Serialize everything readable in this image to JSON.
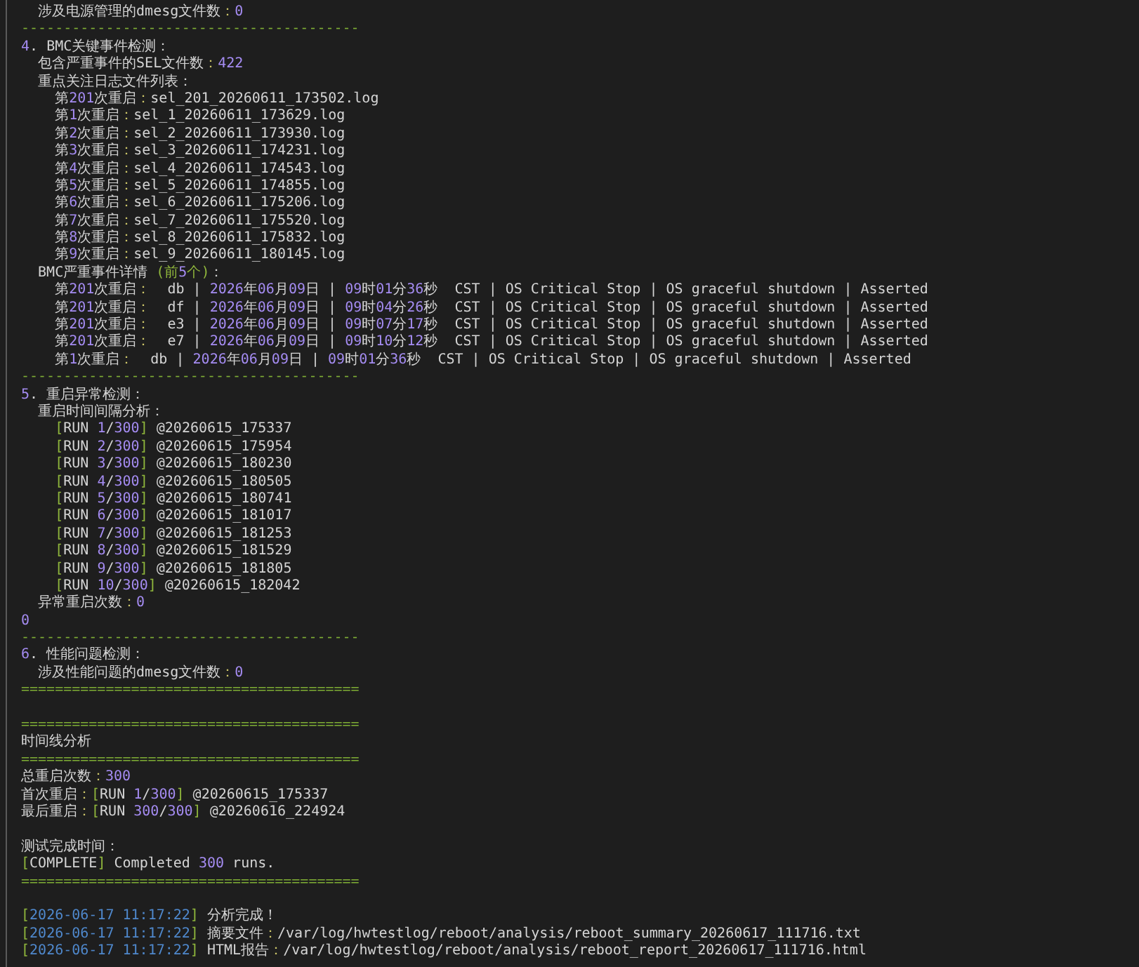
{
  "terminal": {
    "lines": [
      {
        "kind": "text",
        "parts": [
          {
            "kind": "plain",
            "text": "  涉及电源管理的dmesg文件数"
          },
          {
            "kind": "colon",
            "text": "："
          },
          {
            "kind": "num",
            "text": "0"
          }
        ]
      },
      {
        "kind": "rule",
        "text": "----------------------------------------"
      },
      {
        "kind": "text",
        "parts": [
          {
            "kind": "num",
            "text": "4"
          },
          {
            "kind": "plain",
            "text": ". BMC关键事件检测："
          }
        ]
      },
      {
        "kind": "text",
        "parts": [
          {
            "kind": "plain",
            "text": "  包含严重事件的SEL文件数"
          },
          {
            "kind": "colon",
            "text": "："
          },
          {
            "kind": "num",
            "text": "422"
          }
        ]
      },
      {
        "kind": "text",
        "parts": [
          {
            "kind": "plain",
            "text": "  重点关注日志文件列表："
          }
        ]
      },
      {
        "kind": "text",
        "parts": [
          {
            "kind": "plain",
            "text": "    第"
          },
          {
            "kind": "num",
            "text": "201"
          },
          {
            "kind": "plain",
            "text": "次重启"
          },
          {
            "kind": "colon",
            "text": "："
          },
          {
            "kind": "plain",
            "text": "sel_201_20260611_173502.log"
          }
        ]
      },
      {
        "kind": "text",
        "parts": [
          {
            "kind": "plain",
            "text": "    第"
          },
          {
            "kind": "num",
            "text": "1"
          },
          {
            "kind": "plain",
            "text": "次重启"
          },
          {
            "kind": "colon",
            "text": "："
          },
          {
            "kind": "plain",
            "text": "sel_1_20260611_173629.log"
          }
        ]
      },
      {
        "kind": "text",
        "parts": [
          {
            "kind": "plain",
            "text": "    第"
          },
          {
            "kind": "num",
            "text": "2"
          },
          {
            "kind": "plain",
            "text": "次重启"
          },
          {
            "kind": "colon",
            "text": "："
          },
          {
            "kind": "plain",
            "text": "sel_2_20260611_173930.log"
          }
        ]
      },
      {
        "kind": "text",
        "parts": [
          {
            "kind": "plain",
            "text": "    第"
          },
          {
            "kind": "num",
            "text": "3"
          },
          {
            "kind": "plain",
            "text": "次重启"
          },
          {
            "kind": "colon",
            "text": "："
          },
          {
            "kind": "plain",
            "text": "sel_3_20260611_174231.log"
          }
        ]
      },
      {
        "kind": "text",
        "parts": [
          {
            "kind": "plain",
            "text": "    第"
          },
          {
            "kind": "num",
            "text": "4"
          },
          {
            "kind": "plain",
            "text": "次重启"
          },
          {
            "kind": "colon",
            "text": "："
          },
          {
            "kind": "plain",
            "text": "sel_4_20260611_174543.log"
          }
        ]
      },
      {
        "kind": "text",
        "parts": [
          {
            "kind": "plain",
            "text": "    第"
          },
          {
            "kind": "num",
            "text": "5"
          },
          {
            "kind": "plain",
            "text": "次重启"
          },
          {
            "kind": "colon",
            "text": "："
          },
          {
            "kind": "plain",
            "text": "sel_5_20260611_174855.log"
          }
        ]
      },
      {
        "kind": "text",
        "parts": [
          {
            "kind": "plain",
            "text": "    第"
          },
          {
            "kind": "num",
            "text": "6"
          },
          {
            "kind": "plain",
            "text": "次重启"
          },
          {
            "kind": "colon",
            "text": "："
          },
          {
            "kind": "plain",
            "text": "sel_6_20260611_175206.log"
          }
        ]
      },
      {
        "kind": "text",
        "parts": [
          {
            "kind": "plain",
            "text": "    第"
          },
          {
            "kind": "num",
            "text": "7"
          },
          {
            "kind": "plain",
            "text": "次重启"
          },
          {
            "kind": "colon",
            "text": "："
          },
          {
            "kind": "plain",
            "text": "sel_7_20260611_175520.log"
          }
        ]
      },
      {
        "kind": "text",
        "parts": [
          {
            "kind": "plain",
            "text": "    第"
          },
          {
            "kind": "num",
            "text": "8"
          },
          {
            "kind": "plain",
            "text": "次重启"
          },
          {
            "kind": "colon",
            "text": "："
          },
          {
            "kind": "plain",
            "text": "sel_8_20260611_175832.log"
          }
        ]
      },
      {
        "kind": "text",
        "parts": [
          {
            "kind": "plain",
            "text": "    第"
          },
          {
            "kind": "num",
            "text": "9"
          },
          {
            "kind": "plain",
            "text": "次重启"
          },
          {
            "kind": "colon",
            "text": "："
          },
          {
            "kind": "plain",
            "text": "sel_9_20260611_180145.log"
          }
        ]
      },
      {
        "kind": "text",
        "parts": [
          {
            "kind": "plain",
            "text": "  BMC严重事件详情 "
          },
          {
            "kind": "bracket",
            "text": "(前"
          },
          {
            "kind": "num",
            "text": "5"
          },
          {
            "kind": "bracket",
            "text": "个)"
          },
          {
            "kind": "plain",
            "text": "："
          }
        ]
      },
      {
        "kind": "text",
        "parts": [
          {
            "kind": "plain",
            "text": "    第"
          },
          {
            "kind": "num",
            "text": "201"
          },
          {
            "kind": "plain",
            "text": "次重启"
          },
          {
            "kind": "colon",
            "text": "："
          },
          {
            "kind": "plain",
            "text": "  db | "
          },
          {
            "kind": "num",
            "text": "2026"
          },
          {
            "kind": "plain",
            "text": "年"
          },
          {
            "kind": "num",
            "text": "06"
          },
          {
            "kind": "plain",
            "text": "月"
          },
          {
            "kind": "num",
            "text": "09"
          },
          {
            "kind": "plain",
            "text": "日 | "
          },
          {
            "kind": "num",
            "text": "09"
          },
          {
            "kind": "plain",
            "text": "时"
          },
          {
            "kind": "num",
            "text": "01"
          },
          {
            "kind": "plain",
            "text": "分"
          },
          {
            "kind": "num",
            "text": "36"
          },
          {
            "kind": "plain",
            "text": "秒  CST | OS Critical Stop | OS graceful shutdown | Asserted"
          }
        ]
      },
      {
        "kind": "text",
        "parts": [
          {
            "kind": "plain",
            "text": "    第"
          },
          {
            "kind": "num",
            "text": "201"
          },
          {
            "kind": "plain",
            "text": "次重启"
          },
          {
            "kind": "colon",
            "text": "："
          },
          {
            "kind": "plain",
            "text": "  df | "
          },
          {
            "kind": "num",
            "text": "2026"
          },
          {
            "kind": "plain",
            "text": "年"
          },
          {
            "kind": "num",
            "text": "06"
          },
          {
            "kind": "plain",
            "text": "月"
          },
          {
            "kind": "num",
            "text": "09"
          },
          {
            "kind": "plain",
            "text": "日 | "
          },
          {
            "kind": "num",
            "text": "09"
          },
          {
            "kind": "plain",
            "text": "时"
          },
          {
            "kind": "num",
            "text": "04"
          },
          {
            "kind": "plain",
            "text": "分"
          },
          {
            "kind": "num",
            "text": "26"
          },
          {
            "kind": "plain",
            "text": "秒  CST | OS Critical Stop | OS graceful shutdown | Asserted"
          }
        ]
      },
      {
        "kind": "text",
        "parts": [
          {
            "kind": "plain",
            "text": "    第"
          },
          {
            "kind": "num",
            "text": "201"
          },
          {
            "kind": "plain",
            "text": "次重启"
          },
          {
            "kind": "colon",
            "text": "："
          },
          {
            "kind": "plain",
            "text": "  e3 | "
          },
          {
            "kind": "num",
            "text": "2026"
          },
          {
            "kind": "plain",
            "text": "年"
          },
          {
            "kind": "num",
            "text": "06"
          },
          {
            "kind": "plain",
            "text": "月"
          },
          {
            "kind": "num",
            "text": "09"
          },
          {
            "kind": "plain",
            "text": "日 | "
          },
          {
            "kind": "num",
            "text": "09"
          },
          {
            "kind": "plain",
            "text": "时"
          },
          {
            "kind": "num",
            "text": "07"
          },
          {
            "kind": "plain",
            "text": "分"
          },
          {
            "kind": "num",
            "text": "17"
          },
          {
            "kind": "plain",
            "text": "秒  CST | OS Critical Stop | OS graceful shutdown | Asserted"
          }
        ]
      },
      {
        "kind": "text",
        "parts": [
          {
            "kind": "plain",
            "text": "    第"
          },
          {
            "kind": "num",
            "text": "201"
          },
          {
            "kind": "plain",
            "text": "次重启"
          },
          {
            "kind": "colon",
            "text": "："
          },
          {
            "kind": "plain",
            "text": "  e7 | "
          },
          {
            "kind": "num",
            "text": "2026"
          },
          {
            "kind": "plain",
            "text": "年"
          },
          {
            "kind": "num",
            "text": "06"
          },
          {
            "kind": "plain",
            "text": "月"
          },
          {
            "kind": "num",
            "text": "09"
          },
          {
            "kind": "plain",
            "text": "日 | "
          },
          {
            "kind": "num",
            "text": "09"
          },
          {
            "kind": "plain",
            "text": "时"
          },
          {
            "kind": "num",
            "text": "10"
          },
          {
            "kind": "plain",
            "text": "分"
          },
          {
            "kind": "num",
            "text": "12"
          },
          {
            "kind": "plain",
            "text": "秒  CST | OS Critical Stop | OS graceful shutdown | Asserted"
          }
        ]
      },
      {
        "kind": "text",
        "parts": [
          {
            "kind": "plain",
            "text": "    第"
          },
          {
            "kind": "num",
            "text": "1"
          },
          {
            "kind": "plain",
            "text": "次重启"
          },
          {
            "kind": "colon",
            "text": "："
          },
          {
            "kind": "plain",
            "text": "  db | "
          },
          {
            "kind": "num",
            "text": "2026"
          },
          {
            "kind": "plain",
            "text": "年"
          },
          {
            "kind": "num",
            "text": "06"
          },
          {
            "kind": "plain",
            "text": "月"
          },
          {
            "kind": "num",
            "text": "09"
          },
          {
            "kind": "plain",
            "text": "日 | "
          },
          {
            "kind": "num",
            "text": "09"
          },
          {
            "kind": "plain",
            "text": "时"
          },
          {
            "kind": "num",
            "text": "01"
          },
          {
            "kind": "plain",
            "text": "分"
          },
          {
            "kind": "num",
            "text": "36"
          },
          {
            "kind": "plain",
            "text": "秒  CST | OS Critical Stop | OS graceful shutdown | Asserted"
          }
        ]
      },
      {
        "kind": "rule",
        "text": "----------------------------------------"
      },
      {
        "kind": "text",
        "parts": [
          {
            "kind": "num",
            "text": "5"
          },
          {
            "kind": "plain",
            "text": ". 重启异常检测："
          }
        ]
      },
      {
        "kind": "text",
        "parts": [
          {
            "kind": "plain",
            "text": "  重启时间间隔分析："
          }
        ]
      },
      {
        "kind": "text",
        "parts": [
          {
            "kind": "bracket",
            "text": "    ["
          },
          {
            "kind": "plain",
            "text": "RUN "
          },
          {
            "kind": "num",
            "text": "1"
          },
          {
            "kind": "plain",
            "text": "/"
          },
          {
            "kind": "num",
            "text": "300"
          },
          {
            "kind": "bracket",
            "text": "]"
          },
          {
            "kind": "plain",
            "text": " @20260615_175337"
          }
        ]
      },
      {
        "kind": "text",
        "parts": [
          {
            "kind": "bracket",
            "text": "    ["
          },
          {
            "kind": "plain",
            "text": "RUN "
          },
          {
            "kind": "num",
            "text": "2"
          },
          {
            "kind": "plain",
            "text": "/"
          },
          {
            "kind": "num",
            "text": "300"
          },
          {
            "kind": "bracket",
            "text": "]"
          },
          {
            "kind": "plain",
            "text": " @20260615_175954"
          }
        ]
      },
      {
        "kind": "text",
        "parts": [
          {
            "kind": "bracket",
            "text": "    ["
          },
          {
            "kind": "plain",
            "text": "RUN "
          },
          {
            "kind": "num",
            "text": "3"
          },
          {
            "kind": "plain",
            "text": "/"
          },
          {
            "kind": "num",
            "text": "300"
          },
          {
            "kind": "bracket",
            "text": "]"
          },
          {
            "kind": "plain",
            "text": " @20260615_180230"
          }
        ]
      },
      {
        "kind": "text",
        "parts": [
          {
            "kind": "bracket",
            "text": "    ["
          },
          {
            "kind": "plain",
            "text": "RUN "
          },
          {
            "kind": "num",
            "text": "4"
          },
          {
            "kind": "plain",
            "text": "/"
          },
          {
            "kind": "num",
            "text": "300"
          },
          {
            "kind": "bracket",
            "text": "]"
          },
          {
            "kind": "plain",
            "text": " @20260615_180505"
          }
        ]
      },
      {
        "kind": "text",
        "parts": [
          {
            "kind": "bracket",
            "text": "    ["
          },
          {
            "kind": "plain",
            "text": "RUN "
          },
          {
            "kind": "num",
            "text": "5"
          },
          {
            "kind": "plain",
            "text": "/"
          },
          {
            "kind": "num",
            "text": "300"
          },
          {
            "kind": "bracket",
            "text": "]"
          },
          {
            "kind": "plain",
            "text": " @20260615_180741"
          }
        ]
      },
      {
        "kind": "text",
        "parts": [
          {
            "kind": "bracket",
            "text": "    ["
          },
          {
            "kind": "plain",
            "text": "RUN "
          },
          {
            "kind": "num",
            "text": "6"
          },
          {
            "kind": "plain",
            "text": "/"
          },
          {
            "kind": "num",
            "text": "300"
          },
          {
            "kind": "bracket",
            "text": "]"
          },
          {
            "kind": "plain",
            "text": " @20260615_181017"
          }
        ]
      },
      {
        "kind": "text",
        "parts": [
          {
            "kind": "bracket",
            "text": "    ["
          },
          {
            "kind": "plain",
            "text": "RUN "
          },
          {
            "kind": "num",
            "text": "7"
          },
          {
            "kind": "plain",
            "text": "/"
          },
          {
            "kind": "num",
            "text": "300"
          },
          {
            "kind": "bracket",
            "text": "]"
          },
          {
            "kind": "plain",
            "text": " @20260615_181253"
          }
        ]
      },
      {
        "kind": "text",
        "parts": [
          {
            "kind": "bracket",
            "text": "    ["
          },
          {
            "kind": "plain",
            "text": "RUN "
          },
          {
            "kind": "num",
            "text": "8"
          },
          {
            "kind": "plain",
            "text": "/"
          },
          {
            "kind": "num",
            "text": "300"
          },
          {
            "kind": "bracket",
            "text": "]"
          },
          {
            "kind": "plain",
            "text": " @20260615_181529"
          }
        ]
      },
      {
        "kind": "text",
        "parts": [
          {
            "kind": "bracket",
            "text": "    ["
          },
          {
            "kind": "plain",
            "text": "RUN "
          },
          {
            "kind": "num",
            "text": "9"
          },
          {
            "kind": "plain",
            "text": "/"
          },
          {
            "kind": "num",
            "text": "300"
          },
          {
            "kind": "bracket",
            "text": "]"
          },
          {
            "kind": "plain",
            "text": " @20260615_181805"
          }
        ]
      },
      {
        "kind": "text",
        "parts": [
          {
            "kind": "bracket",
            "text": "    ["
          },
          {
            "kind": "plain",
            "text": "RUN "
          },
          {
            "kind": "num",
            "text": "10"
          },
          {
            "kind": "plain",
            "text": "/"
          },
          {
            "kind": "num",
            "text": "300"
          },
          {
            "kind": "bracket",
            "text": "]"
          },
          {
            "kind": "plain",
            "text": " @20260615_182042"
          }
        ]
      },
      {
        "kind": "text",
        "parts": [
          {
            "kind": "plain",
            "text": "  异常重启次数"
          },
          {
            "kind": "colon",
            "text": "："
          },
          {
            "kind": "num",
            "text": "0"
          }
        ]
      },
      {
        "kind": "text",
        "parts": [
          {
            "kind": "num",
            "text": "0"
          }
        ]
      },
      {
        "kind": "rule",
        "text": "----------------------------------------"
      },
      {
        "kind": "text",
        "parts": [
          {
            "kind": "num",
            "text": "6"
          },
          {
            "kind": "plain",
            "text": ". 性能问题检测："
          }
        ]
      },
      {
        "kind": "text",
        "parts": [
          {
            "kind": "plain",
            "text": "  涉及性能问题的dmesg文件数"
          },
          {
            "kind": "colon",
            "text": "："
          },
          {
            "kind": "num",
            "text": "0"
          }
        ]
      },
      {
        "kind": "rule",
        "text": "========================================"
      },
      {
        "kind": "blank"
      },
      {
        "kind": "rule",
        "text": "========================================"
      },
      {
        "kind": "text",
        "parts": [
          {
            "kind": "plain",
            "text": "时间线分析"
          }
        ]
      },
      {
        "kind": "rule",
        "text": "========================================"
      },
      {
        "kind": "text",
        "parts": [
          {
            "kind": "plain",
            "text": "总重启次数"
          },
          {
            "kind": "colon",
            "text": "："
          },
          {
            "kind": "num",
            "text": "300"
          }
        ]
      },
      {
        "kind": "text",
        "parts": [
          {
            "kind": "plain",
            "text": "首次重启"
          },
          {
            "kind": "colon",
            "text": "："
          },
          {
            "kind": "bracket",
            "text": "["
          },
          {
            "kind": "plain",
            "text": "RUN "
          },
          {
            "kind": "num",
            "text": "1"
          },
          {
            "kind": "plain",
            "text": "/"
          },
          {
            "kind": "num",
            "text": "300"
          },
          {
            "kind": "bracket",
            "text": "]"
          },
          {
            "kind": "plain",
            "text": " @20260615_175337"
          }
        ]
      },
      {
        "kind": "text",
        "parts": [
          {
            "kind": "plain",
            "text": "最后重启"
          },
          {
            "kind": "colon",
            "text": "："
          },
          {
            "kind": "bracket",
            "text": "["
          },
          {
            "kind": "plain",
            "text": "RUN "
          },
          {
            "kind": "num",
            "text": "300"
          },
          {
            "kind": "plain",
            "text": "/"
          },
          {
            "kind": "num",
            "text": "300"
          },
          {
            "kind": "bracket",
            "text": "]"
          },
          {
            "kind": "plain",
            "text": " @20260616_224924"
          }
        ]
      },
      {
        "kind": "blank"
      },
      {
        "kind": "text",
        "parts": [
          {
            "kind": "plain",
            "text": "测试完成时间："
          }
        ]
      },
      {
        "kind": "text",
        "parts": [
          {
            "kind": "bracket",
            "text": "["
          },
          {
            "kind": "plain",
            "text": "COMPLETE"
          },
          {
            "kind": "bracket",
            "text": "]"
          },
          {
            "kind": "plain",
            "text": " Completed "
          },
          {
            "kind": "num",
            "text": "300"
          },
          {
            "kind": "plain",
            "text": " runs."
          }
        ]
      },
      {
        "kind": "rule",
        "text": "========================================"
      },
      {
        "kind": "blank"
      },
      {
        "kind": "text",
        "parts": [
          {
            "kind": "bracket",
            "text": "["
          },
          {
            "kind": "time",
            "text": "2026-06-17 11:17:22"
          },
          {
            "kind": "bracket",
            "text": "]"
          },
          {
            "kind": "plain",
            "text": " 分析完成！"
          }
        ]
      },
      {
        "kind": "text",
        "parts": [
          {
            "kind": "bracket",
            "text": "["
          },
          {
            "kind": "time",
            "text": "2026-06-17 11:17:22"
          },
          {
            "kind": "bracket",
            "text": "]"
          },
          {
            "kind": "plain",
            "text": " 摘要文件"
          },
          {
            "kind": "colon",
            "text": "："
          },
          {
            "kind": "plain",
            "text": "/var/log/hwtestlog/reboot/analysis/reboot_summary_20260617_111716.txt"
          }
        ]
      },
      {
        "kind": "text",
        "parts": [
          {
            "kind": "bracket",
            "text": "["
          },
          {
            "kind": "time",
            "text": "2026-06-17 11:17:22"
          },
          {
            "kind": "bracket",
            "text": "]"
          },
          {
            "kind": "plain",
            "text": " HTML报告"
          },
          {
            "kind": "colon",
            "text": "："
          },
          {
            "kind": "plain",
            "text": "/var/log/hwtestlog/reboot/analysis/reboot_report_20260617_111716.html"
          }
        ]
      }
    ]
  }
}
